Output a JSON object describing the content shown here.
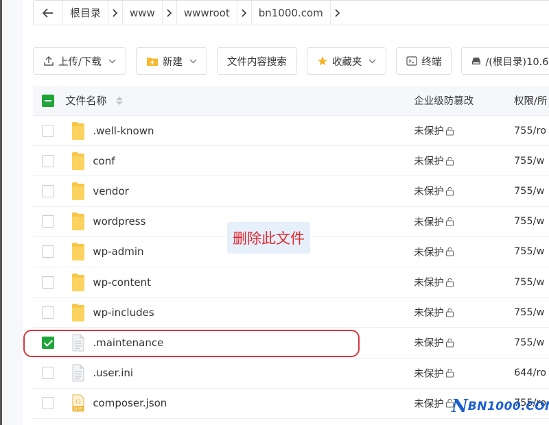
{
  "breadcrumb": {
    "segments": [
      "根目录",
      "www",
      "wwwroot",
      "bn1000.com"
    ]
  },
  "toolbar": {
    "upload_download": "上传/下载",
    "new": "新建",
    "search_content": "文件内容搜索",
    "favorites": "收藏夹",
    "terminal": "终端",
    "disk": "/(根目录)10.6"
  },
  "table": {
    "headers": {
      "name": "文件名称",
      "protection": "企业级防篡改",
      "permission": "权限/所"
    },
    "rows": [
      {
        "name": ".well-known",
        "type": "folder",
        "protection": "未保护",
        "permission": "755/ro",
        "checked": false
      },
      {
        "name": "conf",
        "type": "folder",
        "protection": "未保护",
        "permission": "755/w",
        "checked": false
      },
      {
        "name": "vendor",
        "type": "folder",
        "protection": "未保护",
        "permission": "755/w",
        "checked": false
      },
      {
        "name": "wordpress",
        "type": "folder",
        "protection": "未保护",
        "permission": "755/w",
        "checked": false
      },
      {
        "name": "wp-admin",
        "type": "folder",
        "protection": "未保护",
        "permission": "755/w",
        "checked": false
      },
      {
        "name": "wp-content",
        "type": "folder",
        "protection": "未保护",
        "permission": "755/w",
        "checked": false
      },
      {
        "name": "wp-includes",
        "type": "folder",
        "protection": "未保护",
        "permission": "755/w",
        "checked": false
      },
      {
        "name": ".maintenance",
        "type": "file",
        "protection": "未保护",
        "permission": "755/w",
        "checked": true
      },
      {
        "name": ".user.ini",
        "type": "file",
        "protection": "未保护",
        "permission": "644/ro",
        "checked": false
      },
      {
        "name": "composer.json",
        "type": "json",
        "protection": "未保护",
        "permission": "755/ro",
        "checked": false
      }
    ]
  },
  "annotation": "删除此文件",
  "watermark": "BN1000.COM",
  "watermark_letter": "N",
  "colors": {
    "accent": "#20a53a",
    "highlight": "#d9363e",
    "annotation": "#e0262e",
    "watermark": "#1a5fd0"
  }
}
